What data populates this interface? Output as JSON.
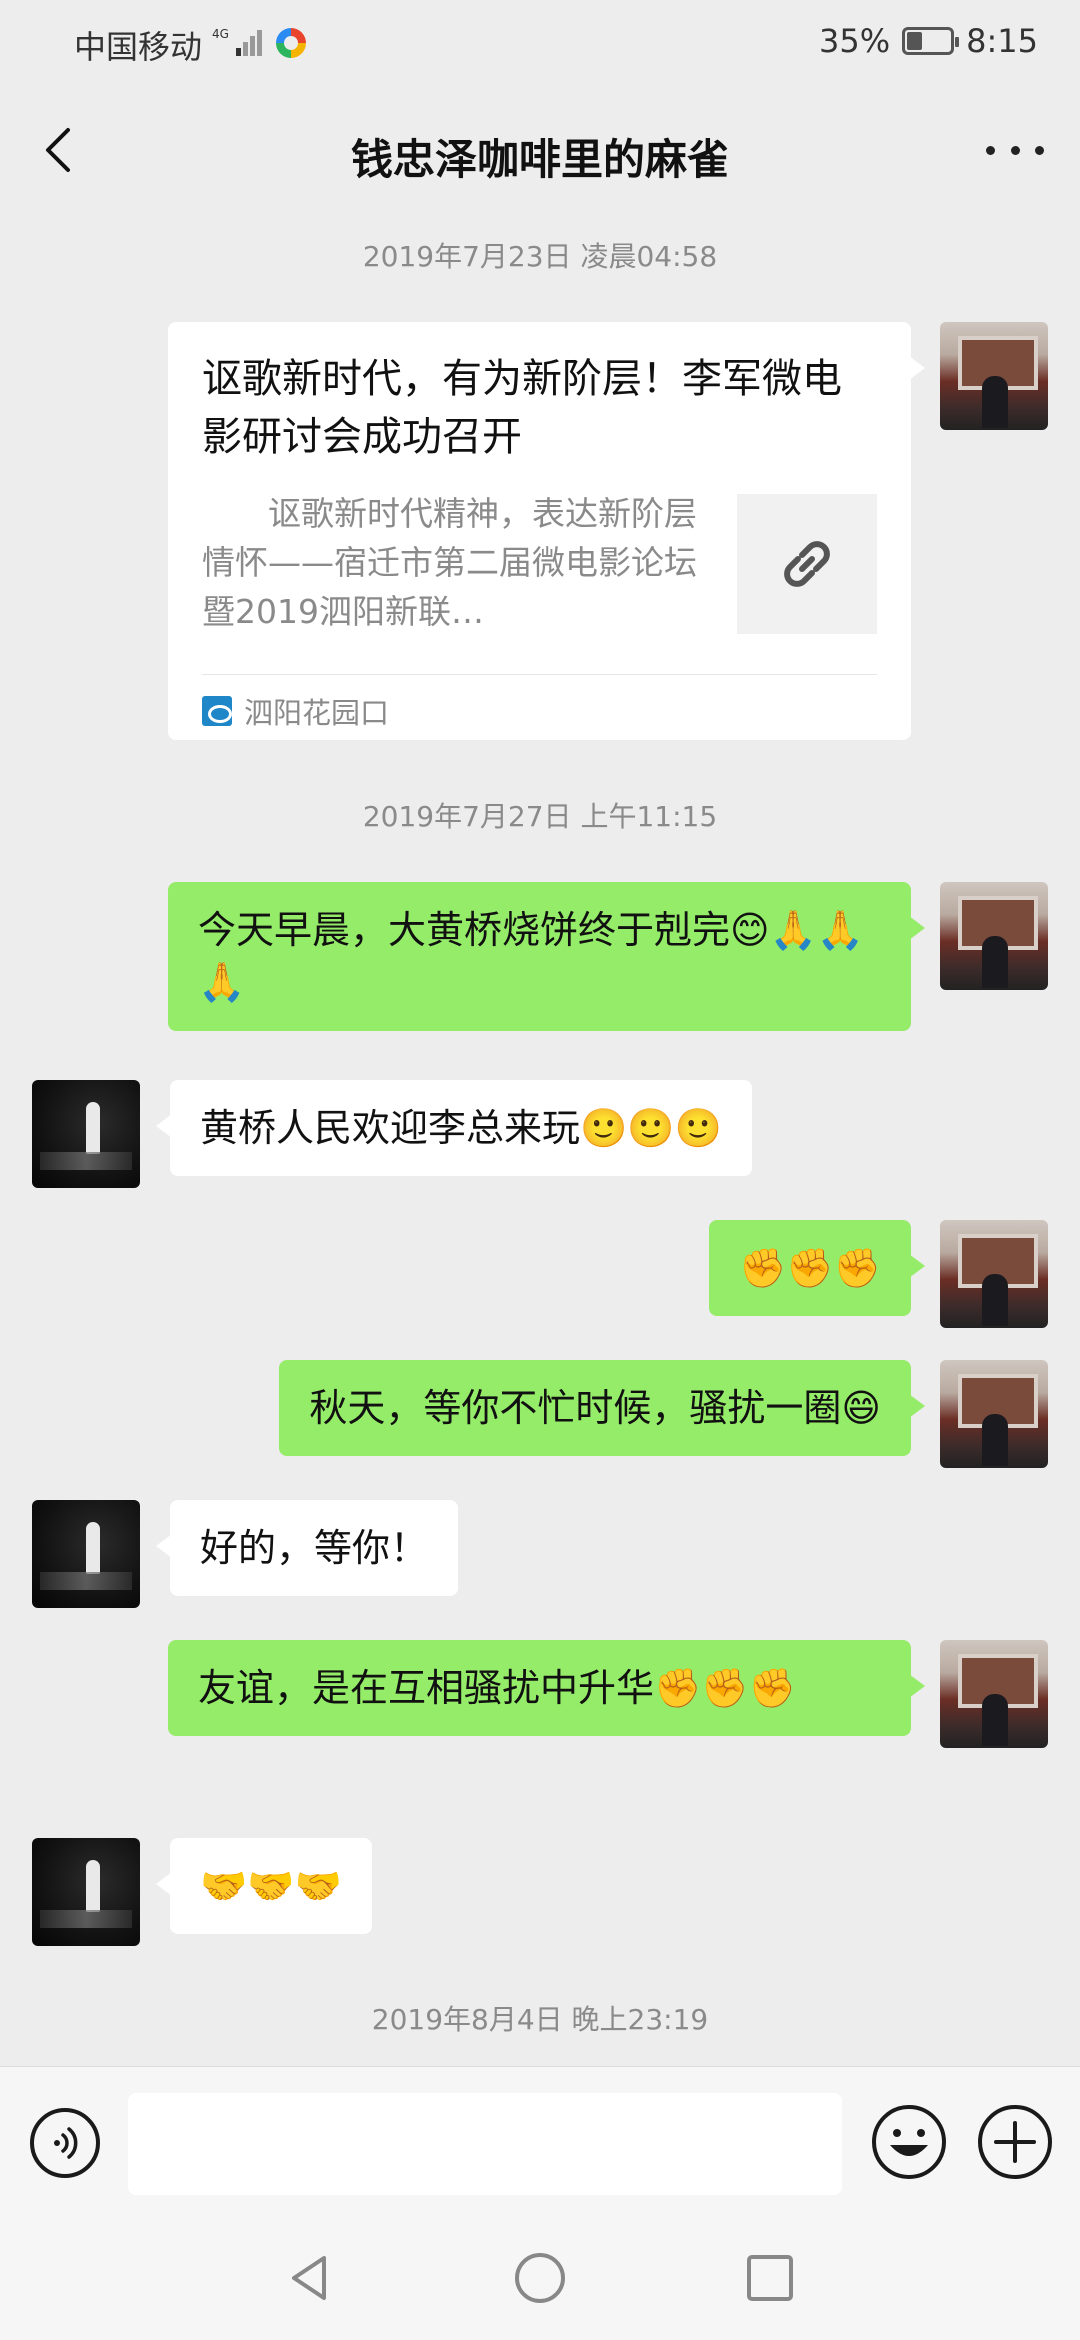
{
  "status_bar": {
    "carrier": "中国移动",
    "network": "4G",
    "battery": "35%",
    "battery_level": 0.35,
    "time": "8:15"
  },
  "header": {
    "title": "钱忠泽咖啡里的麻雀",
    "back_icon": "chevron-left-icon",
    "more_icon": "more-dots-icon"
  },
  "timestamps": [
    "2019年7月23日 凌晨04:58",
    "2019年7月27日 上午11:15",
    "2019年8月4日 晚上23:19"
  ],
  "link_card": {
    "title": "讴歌新时代，有为新阶层！李军微电影研讨会成功召开",
    "description": "讴歌新时代精神，表达新阶层情怀——宿迁市第二届微电影论坛暨2019泗阳新联…",
    "source": "泗阳花园口",
    "thumb_icon": "link-icon"
  },
  "messages": [
    {
      "side": "me",
      "text": "今天早晨，大黄桥烧饼终于剋完😊🙏🙏🙏"
    },
    {
      "side": "other",
      "text": "黄桥人民欢迎李总来玩🙂🙂🙂"
    },
    {
      "side": "me",
      "text": "✊✊✊"
    },
    {
      "side": "me",
      "text": "秋天，等你不忙时候，骚扰一圈😄"
    },
    {
      "side": "other",
      "text": "好的，等你！"
    },
    {
      "side": "me",
      "text": "友谊，是在互相骚扰中升华✊✊✊"
    },
    {
      "side": "other",
      "text": "🤝🤝🤝"
    }
  ],
  "input_bar": {
    "value": "",
    "voice_icon": "voice-icon",
    "emoji_icon": "emoji-icon",
    "plus_icon": "plus-icon"
  },
  "system_nav": {
    "back_icon": "nav-back-icon",
    "home_icon": "nav-home-icon",
    "recents_icon": "nav-recents-icon"
  }
}
